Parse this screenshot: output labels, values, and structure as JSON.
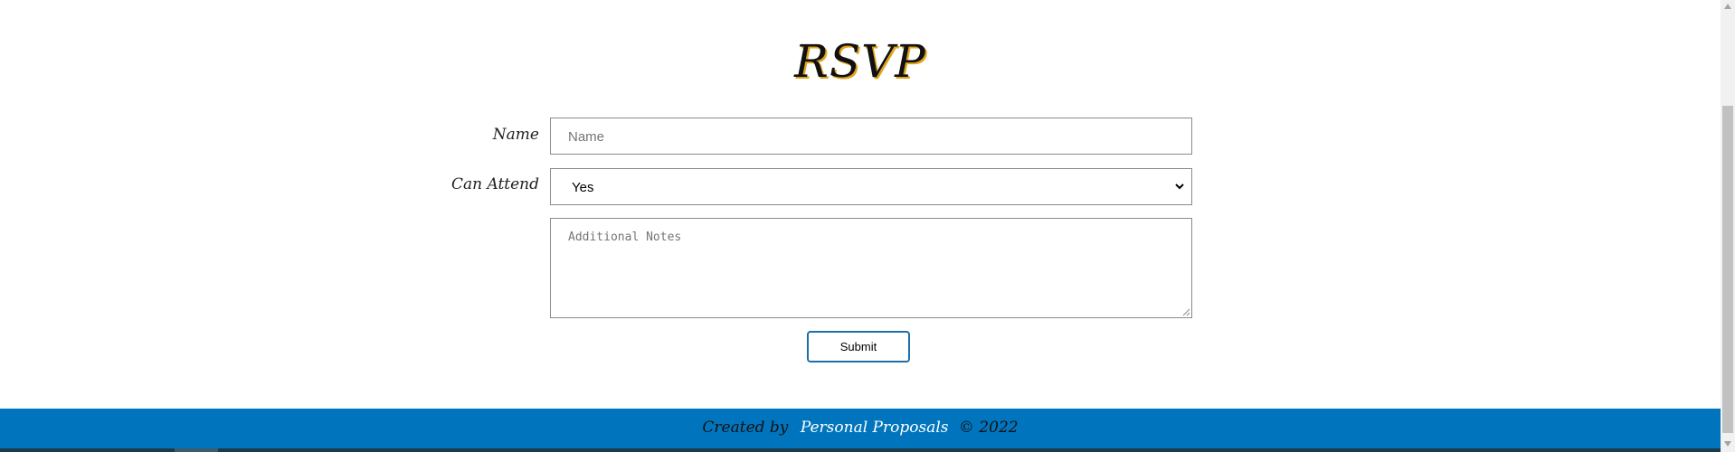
{
  "form": {
    "title": "RSVP",
    "name_label": "Name",
    "name_placeholder": "Name",
    "attend_label": "Can Attend",
    "attend_value": "Yes",
    "notes_placeholder": "Additional Notes",
    "submit_label": "Submit"
  },
  "footer": {
    "created_by": "Created by",
    "brand": "Personal Proposals",
    "copyright": "© 2022"
  },
  "colors": {
    "footer_bg": "#0075be",
    "button_border": "#1e6fa8",
    "title_shadow": "#e0a318"
  }
}
